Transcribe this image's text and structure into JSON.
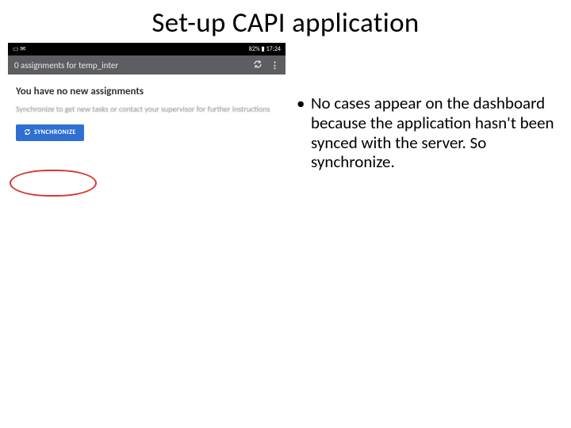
{
  "slide": {
    "title": "Set-up CAPI application"
  },
  "phone": {
    "statusbar": {
      "left_icons": "▭ ✉",
      "right_text": "82% ▮ 17:24"
    },
    "appbar": {
      "title": "0 assignments for temp_inter",
      "icon_sync_name": "sync",
      "icon_more_name": "more"
    },
    "content": {
      "heading": "You have no new assignments",
      "subtext": "Synchronize to get new tasks or contact your supervisor for further instructions",
      "sync_button_label": "SYNCHRONIZE"
    }
  },
  "bullets": {
    "items": [
      "No cases appear on the dashboard because the application hasn't been synced with the server. So synchronize."
    ]
  }
}
